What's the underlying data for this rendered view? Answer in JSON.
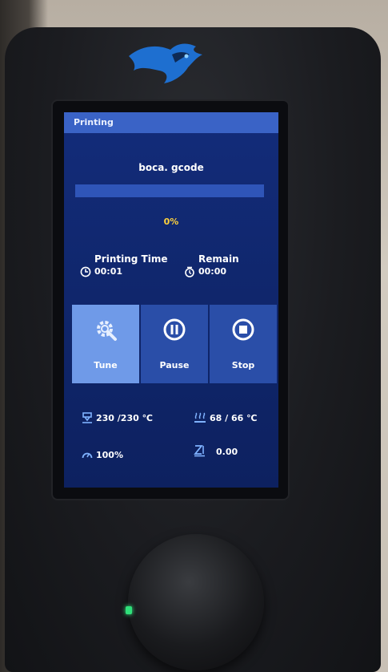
{
  "screen": {
    "title": "Printing",
    "filename": "boca. gcode",
    "progress_fraction": 0.0,
    "progress_text": "0%"
  },
  "stats": {
    "printing_time_label": "Printing Time",
    "printing_time_value": "00:01",
    "remain_label": "Remain",
    "remain_value": "00:00"
  },
  "buttons": {
    "tune": "Tune",
    "pause": "Pause",
    "stop": "Stop"
  },
  "readouts": {
    "nozzle_temp": "230 /230 ℃",
    "bed_temp": "68 / 66 ℃",
    "speed": "100%",
    "z_offset": "0.00"
  },
  "colors": {
    "screen_bg": "#132c7a",
    "titlebar": "#3a63c6",
    "button": "#2a4ea8",
    "button_active": "#6f9ae8",
    "percent_text": "#ffd23c",
    "icon_accent": "#7fb2ff"
  },
  "icons": {
    "logo": "dragon-logo-icon",
    "clock": "clock-icon",
    "remain": "timer-icon",
    "tune": "gear-wrench-icon",
    "pause": "pause-icon",
    "stop": "stop-icon",
    "nozzle": "nozzle-icon",
    "bed": "heated-bed-icon",
    "speed": "speedometer-icon",
    "z": "z-axis-icon"
  }
}
